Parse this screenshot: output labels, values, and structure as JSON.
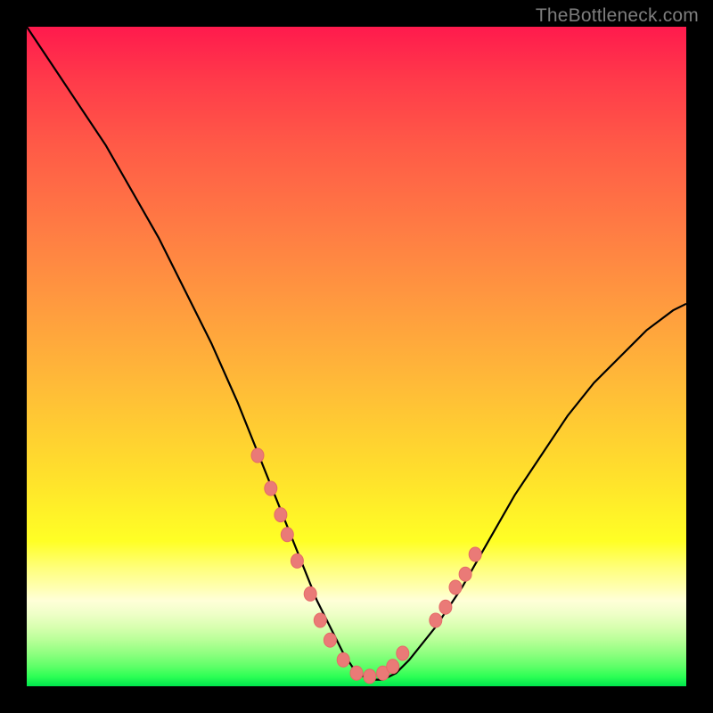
{
  "watermark": "TheBottleneck.com",
  "colors": {
    "frame": "#000000",
    "curve": "#000000",
    "marker_fill": "#ea7a77",
    "marker_stroke": "#e56a67"
  },
  "chart_data": {
    "type": "line",
    "title": "",
    "xlabel": "",
    "ylabel": "",
    "xlim": [
      0,
      100
    ],
    "ylim": [
      0,
      100
    ],
    "note": "x is normalized position across plot (0=left,100=right); y is curve height above bottom (0=bottom,100=top). No axis ticks or numeric labels are rendered in the source image; values are geometric estimates of the drawn curve.",
    "series": [
      {
        "name": "bottleneck-curve",
        "x": [
          0,
          4,
          8,
          12,
          16,
          20,
          24,
          28,
          32,
          36,
          38,
          40,
          42,
          44,
          46,
          48,
          50,
          52,
          54,
          56,
          58,
          62,
          66,
          70,
          74,
          78,
          82,
          86,
          90,
          94,
          98,
          100
        ],
        "y": [
          100,
          94,
          88,
          82,
          75,
          68,
          60,
          52,
          43,
          33,
          28,
          23,
          18,
          13,
          9,
          5,
          2,
          1,
          1,
          2,
          4,
          9,
          15,
          22,
          29,
          35,
          41,
          46,
          50,
          54,
          57,
          58
        ]
      }
    ],
    "markers": {
      "name": "highlighted-points",
      "approx_xy": [
        [
          35,
          35
        ],
        [
          37,
          30
        ],
        [
          38.5,
          26
        ],
        [
          39.5,
          23
        ],
        [
          41,
          19
        ],
        [
          43,
          14
        ],
        [
          44.5,
          10
        ],
        [
          46,
          7
        ],
        [
          48,
          4
        ],
        [
          50,
          2
        ],
        [
          52,
          1.5
        ],
        [
          54,
          2
        ],
        [
          55.5,
          3
        ],
        [
          57,
          5
        ],
        [
          62,
          10
        ],
        [
          63.5,
          12
        ],
        [
          65,
          15
        ],
        [
          66.5,
          17
        ],
        [
          68,
          20
        ]
      ]
    }
  }
}
